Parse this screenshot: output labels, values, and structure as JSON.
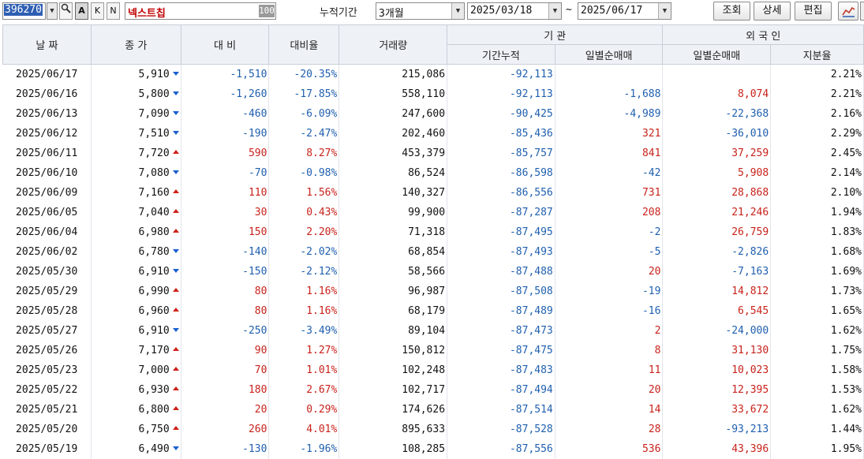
{
  "toolbar": {
    "code": "396270",
    "btn_a": "A",
    "btn_k": "K",
    "btn_n": "N",
    "stock_name": "넥스트칩",
    "name_suffix": "100",
    "period_label": "누적기간",
    "period_value": "3개월",
    "start_date": "2025/03/18",
    "tilde": "~",
    "end_date": "2025/06/17",
    "query_label": "조회",
    "detail_label": "상세",
    "edit_label": "편집"
  },
  "header": {
    "date": "날 짜",
    "close": "종 가",
    "change": "대 비",
    "rate": "대비율",
    "volume": "거래량",
    "institution": "기    관",
    "inst_cum": "기간누적",
    "inst_daily": "일별순매매",
    "foreign": "외 국 인",
    "for_daily": "일별순매매",
    "for_share": "지분율"
  },
  "colors": {
    "up": "#c8221b",
    "down": "#1f5fae"
  },
  "rows": [
    {
      "date": "2025/06/17",
      "close": "5,910",
      "dir": "down",
      "change": "-1,510",
      "rate": "-20.35%",
      "volume": "215,086",
      "inst_cum": "-92,113",
      "inst_daily": "",
      "for_daily": "",
      "for_share": "2.21%"
    },
    {
      "date": "2025/06/16",
      "close": "5,800",
      "dir": "down",
      "change": "-1,260",
      "rate": "-17.85%",
      "volume": "558,110",
      "inst_cum": "-92,113",
      "inst_daily": "-1,688",
      "for_daily": "8,074",
      "for_share": "2.21%"
    },
    {
      "date": "2025/06/13",
      "close": "7,090",
      "dir": "down",
      "change": "-460",
      "rate": "-6.09%",
      "volume": "247,600",
      "inst_cum": "-90,425",
      "inst_daily": "-4,989",
      "for_daily": "-22,368",
      "for_share": "2.16%"
    },
    {
      "date": "2025/06/12",
      "close": "7,510",
      "dir": "down",
      "change": "-190",
      "rate": "-2.47%",
      "volume": "202,460",
      "inst_cum": "-85,436",
      "inst_daily": "321",
      "for_daily": "-36,010",
      "for_share": "2.29%"
    },
    {
      "date": "2025/06/11",
      "close": "7,720",
      "dir": "up",
      "change": "590",
      "rate": "8.27%",
      "volume": "453,379",
      "inst_cum": "-85,757",
      "inst_daily": "841",
      "for_daily": "37,259",
      "for_share": "2.45%"
    },
    {
      "date": "2025/06/10",
      "close": "7,080",
      "dir": "down",
      "change": "-70",
      "rate": "-0.98%",
      "volume": "86,524",
      "inst_cum": "-86,598",
      "inst_daily": "-42",
      "for_daily": "5,908",
      "for_share": "2.14%"
    },
    {
      "date": "2025/06/09",
      "close": "7,160",
      "dir": "up",
      "change": "110",
      "rate": "1.56%",
      "volume": "140,327",
      "inst_cum": "-86,556",
      "inst_daily": "731",
      "for_daily": "28,868",
      "for_share": "2.10%"
    },
    {
      "date": "2025/06/05",
      "close": "7,040",
      "dir": "up",
      "change": "30",
      "rate": "0.43%",
      "volume": "99,900",
      "inst_cum": "-87,287",
      "inst_daily": "208",
      "for_daily": "21,246",
      "for_share": "1.94%"
    },
    {
      "date": "2025/06/04",
      "close": "6,980",
      "dir": "up",
      "change": "150",
      "rate": "2.20%",
      "volume": "71,318",
      "inst_cum": "-87,495",
      "inst_daily": "-2",
      "for_daily": "26,759",
      "for_share": "1.83%"
    },
    {
      "date": "2025/06/02",
      "close": "6,780",
      "dir": "down",
      "change": "-140",
      "rate": "-2.02%",
      "volume": "68,854",
      "inst_cum": "-87,493",
      "inst_daily": "-5",
      "for_daily": "-2,826",
      "for_share": "1.68%"
    },
    {
      "date": "2025/05/30",
      "close": "6,910",
      "dir": "down",
      "change": "-150",
      "rate": "-2.12%",
      "volume": "58,566",
      "inst_cum": "-87,488",
      "inst_daily": "20",
      "for_daily": "-7,163",
      "for_share": "1.69%"
    },
    {
      "date": "2025/05/29",
      "close": "6,990",
      "dir": "up",
      "change": "80",
      "rate": "1.16%",
      "volume": "96,987",
      "inst_cum": "-87,508",
      "inst_daily": "-19",
      "for_daily": "14,812",
      "for_share": "1.73%"
    },
    {
      "date": "2025/05/28",
      "close": "6,960",
      "dir": "up",
      "change": "80",
      "rate": "1.16%",
      "volume": "68,179",
      "inst_cum": "-87,489",
      "inst_daily": "-16",
      "for_daily": "6,545",
      "for_share": "1.65%"
    },
    {
      "date": "2025/05/27",
      "close": "6,910",
      "dir": "down",
      "change": "-250",
      "rate": "-3.49%",
      "volume": "89,104",
      "inst_cum": "-87,473",
      "inst_daily": "2",
      "for_daily": "-24,000",
      "for_share": "1.62%"
    },
    {
      "date": "2025/05/26",
      "close": "7,170",
      "dir": "up",
      "change": "90",
      "rate": "1.27%",
      "volume": "150,812",
      "inst_cum": "-87,475",
      "inst_daily": "8",
      "for_daily": "31,130",
      "for_share": "1.75%"
    },
    {
      "date": "2025/05/23",
      "close": "7,000",
      "dir": "up",
      "change": "70",
      "rate": "1.01%",
      "volume": "102,248",
      "inst_cum": "-87,483",
      "inst_daily": "11",
      "for_daily": "10,023",
      "for_share": "1.58%"
    },
    {
      "date": "2025/05/22",
      "close": "6,930",
      "dir": "up",
      "change": "180",
      "rate": "2.67%",
      "volume": "102,717",
      "inst_cum": "-87,494",
      "inst_daily": "20",
      "for_daily": "12,395",
      "for_share": "1.53%"
    },
    {
      "date": "2025/05/21",
      "close": "6,800",
      "dir": "up",
      "change": "20",
      "rate": "0.29%",
      "volume": "174,626",
      "inst_cum": "-87,514",
      "inst_daily": "14",
      "for_daily": "33,672",
      "for_share": "1.62%"
    },
    {
      "date": "2025/05/20",
      "close": "6,750",
      "dir": "up",
      "change": "260",
      "rate": "4.01%",
      "volume": "895,633",
      "inst_cum": "-87,528",
      "inst_daily": "28",
      "for_daily": "-93,213",
      "for_share": "1.44%"
    },
    {
      "date": "2025/05/19",
      "close": "6,490",
      "dir": "down",
      "change": "-130",
      "rate": "-1.96%",
      "volume": "108,285",
      "inst_cum": "-87,556",
      "inst_daily": "536",
      "for_daily": "43,396",
      "for_share": "1.95%"
    }
  ]
}
